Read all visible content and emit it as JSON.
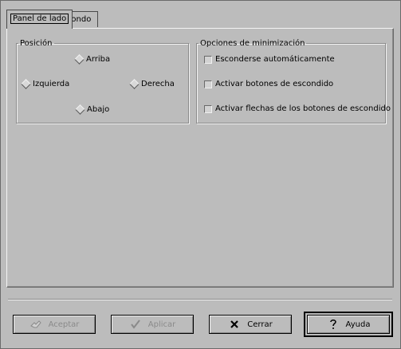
{
  "tabs": [
    {
      "label": "Panel de lado",
      "active": true
    },
    {
      "label": "Fondo",
      "active": false
    }
  ],
  "position_group": {
    "legend": "Posición",
    "options": {
      "top": "Arriba",
      "left": "Izquierda",
      "right": "Derecha",
      "bottom": "Abajo"
    }
  },
  "minimize_group": {
    "legend": "Opciones de minimización",
    "options": [
      {
        "label": "Esconderse automáticamente",
        "checked": false
      },
      {
        "label": "Activar botones de escondido",
        "checked": false
      },
      {
        "label": "Activar flechas de los botones de escondido",
        "checked": false
      }
    ]
  },
  "buttons": {
    "ok": "Aceptar",
    "apply": "Aplicar",
    "close": "Cerrar",
    "help": "Ayuda"
  },
  "icons": {
    "ok": "thumbs-icon",
    "apply": "checkmark-icon",
    "close": "x-icon",
    "help": "question-icon"
  }
}
